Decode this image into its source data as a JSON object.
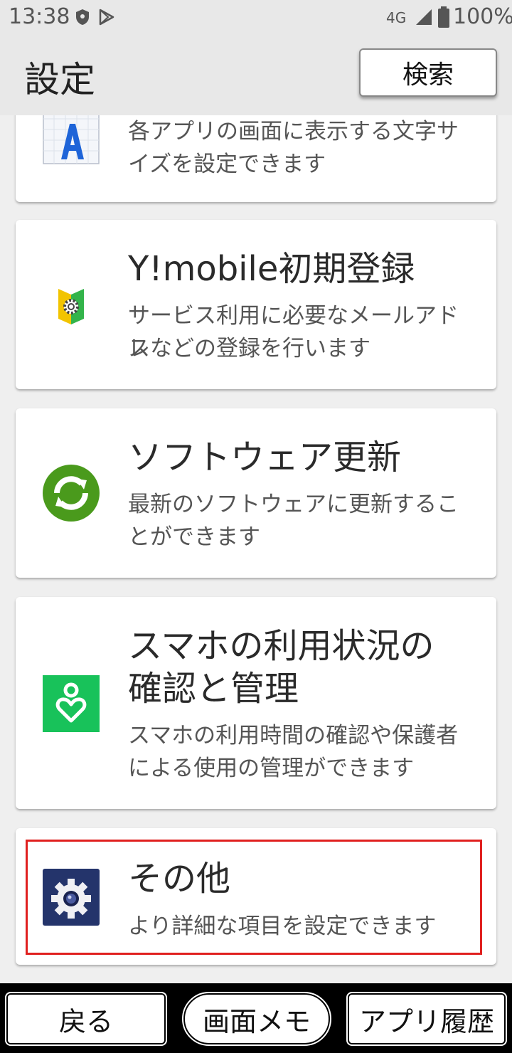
{
  "status_bar": {
    "time": "13:38",
    "network": "4G",
    "battery": "100%"
  },
  "header": {
    "title": "設定",
    "search_label": "検索"
  },
  "cards": [
    {
      "title": "",
      "description_line1": "各アプリの画面に表示する文字サ",
      "description_line2": "イズを設定できます",
      "icon": "font-size-icon"
    },
    {
      "title": "Y!mobile初期登録",
      "description_line1": "サービス利用に必要なメールアドレ",
      "description_line2": "スなどの登録を行います",
      "icon": "ymobile-setup-icon"
    },
    {
      "title": "ソフトウェア更新",
      "description_line1": "最新のソフトウェアに更新するこ",
      "description_line2": "とができます",
      "icon": "software-update-icon"
    },
    {
      "title_line1": "スマホの利用状況の",
      "title_line2": "確認と管理",
      "description_line1": "スマホの利用時間の確認や保護者",
      "description_line2": "による使用の管理ができます",
      "icon": "digital-wellbeing-icon"
    },
    {
      "title": "その他",
      "description_line1": "より詳細な項目を設定できます",
      "icon": "gear-icon",
      "highlighted": true
    }
  ],
  "bottom_nav": {
    "back": "戻る",
    "screen_memo": "画面メモ",
    "app_history": "アプリ履歴"
  },
  "colors": {
    "highlight": "#e0201f",
    "update_green": "#4a9a1c",
    "wellbeing_green": "#18c25a",
    "gear_navy": "#24346b"
  }
}
